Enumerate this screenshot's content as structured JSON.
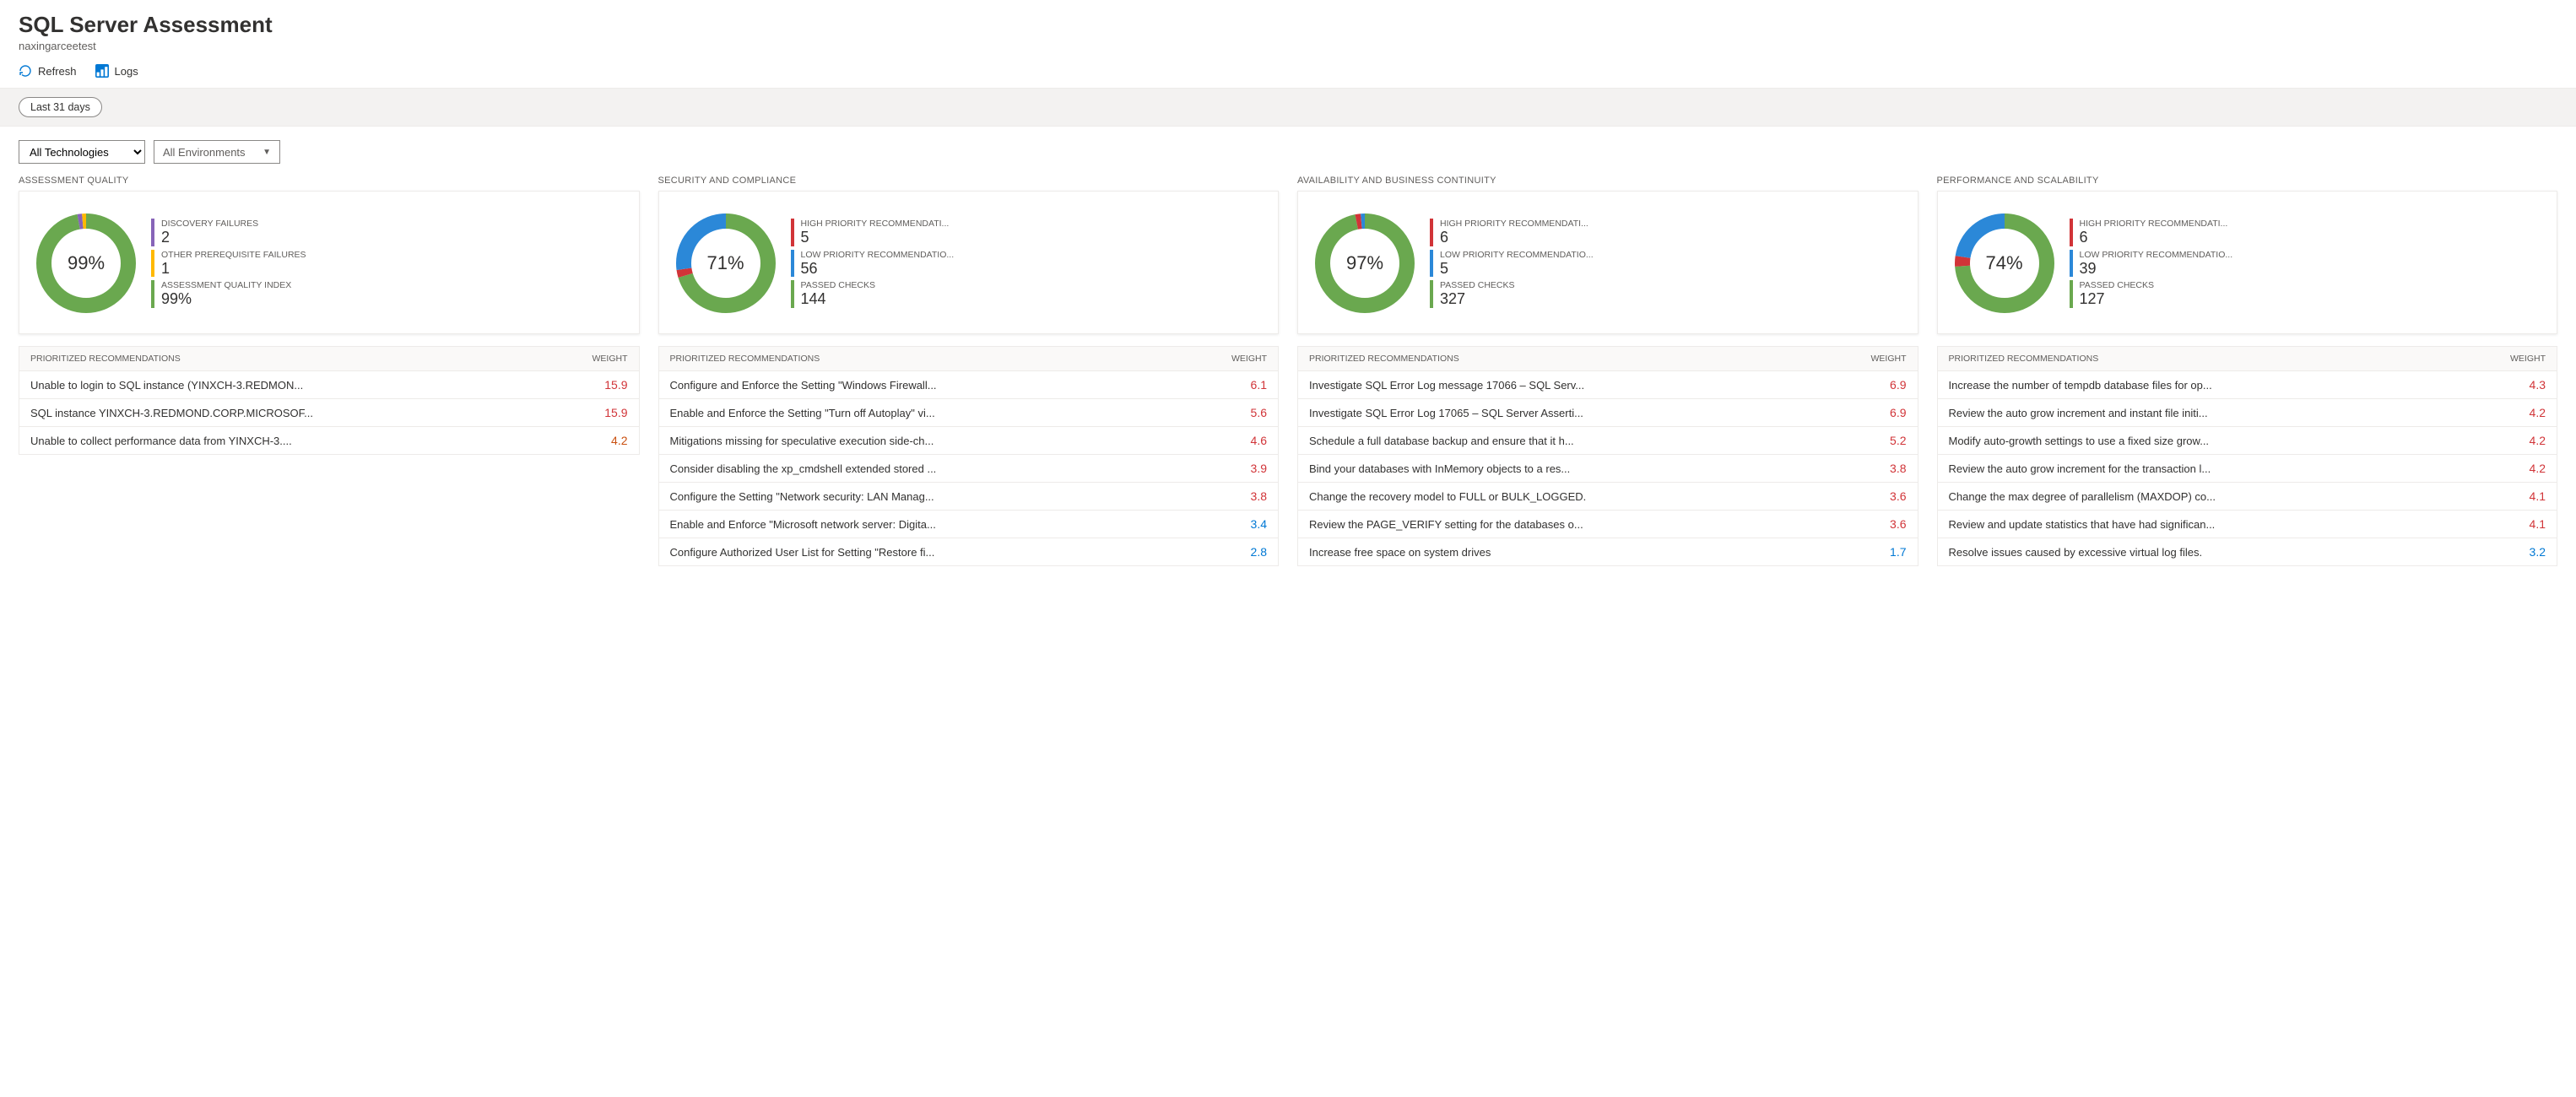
{
  "header": {
    "title": "SQL Server Assessment",
    "subtitle": "naxingarceetest"
  },
  "toolbar": {
    "refresh": "Refresh",
    "logs": "Logs"
  },
  "filter": {
    "range": "Last 31 days",
    "technologies": "All Technologies",
    "environments": "All Environments"
  },
  "labels": {
    "prioritized": "PRIORITIZED RECOMMENDATIONS",
    "weight": "WEIGHT"
  },
  "colors": {
    "green": "#6aa84f",
    "red": "#d13438",
    "blue": "#2b88d8",
    "purple": "#8764b8",
    "yellow": "#ffb900"
  },
  "cols": [
    {
      "title": "ASSESSMENT QUALITY",
      "center": "99%",
      "segments": [
        {
          "color": "#6aa84f",
          "pct": 97
        },
        {
          "color": "#8764b8",
          "pct": 1.5
        },
        {
          "color": "#ffb900",
          "pct": 1.5
        }
      ],
      "legend": [
        {
          "label": "DISCOVERY FAILURES",
          "value": "2",
          "color": "#8764b8"
        },
        {
          "label": "OTHER PREREQUISITE FAILURES",
          "value": "1",
          "color": "#ffb900"
        },
        {
          "label": "ASSESSMENT QUALITY INDEX",
          "value": "99%",
          "color": "#6aa84f"
        }
      ],
      "rows": [
        {
          "text": "Unable to login to SQL instance (YINXCH-3.REDMON...",
          "weight": "15.9",
          "cls": "w-red"
        },
        {
          "text": "SQL instance YINXCH-3.REDMOND.CORP.MICROSOF...",
          "weight": "15.9",
          "cls": "w-red"
        },
        {
          "text": "Unable to collect performance data from YINXCH-3....",
          "weight": "4.2",
          "cls": "w-orange"
        }
      ]
    },
    {
      "title": "SECURITY AND COMPLIANCE",
      "center": "71%",
      "segments": [
        {
          "color": "#6aa84f",
          "pct": 70.2
        },
        {
          "color": "#d13438",
          "pct": 2.5
        },
        {
          "color": "#2b88d8",
          "pct": 27.3
        }
      ],
      "legend": [
        {
          "label": "HIGH PRIORITY RECOMMENDATI...",
          "value": "5",
          "color": "#d13438"
        },
        {
          "label": "LOW PRIORITY RECOMMENDATIO...",
          "value": "56",
          "color": "#2b88d8"
        },
        {
          "label": "PASSED CHECKS",
          "value": "144",
          "color": "#6aa84f"
        }
      ],
      "rows": [
        {
          "text": "Configure and Enforce the Setting \"Windows Firewall...",
          "weight": "6.1",
          "cls": "w-red"
        },
        {
          "text": "Enable and Enforce the Setting \"Turn off Autoplay\" vi...",
          "weight": "5.6",
          "cls": "w-red"
        },
        {
          "text": "Mitigations missing for speculative execution side-ch...",
          "weight": "4.6",
          "cls": "w-red"
        },
        {
          "text": "Consider disabling the xp_cmdshell extended stored ...",
          "weight": "3.9",
          "cls": "w-red"
        },
        {
          "text": "Configure the Setting \"Network security: LAN Manag...",
          "weight": "3.8",
          "cls": "w-red"
        },
        {
          "text": "Enable and Enforce \"Microsoft network server: Digita...",
          "weight": "3.4",
          "cls": "w-blue"
        },
        {
          "text": "Configure Authorized User List for Setting \"Restore fi...",
          "weight": "2.8",
          "cls": "w-blue"
        }
      ]
    },
    {
      "title": "AVAILABILITY AND BUSINESS CONTINUITY",
      "center": "97%",
      "segments": [
        {
          "color": "#6aa84f",
          "pct": 96.7
        },
        {
          "color": "#d13438",
          "pct": 1.8
        },
        {
          "color": "#2b88d8",
          "pct": 1.5
        }
      ],
      "legend": [
        {
          "label": "HIGH PRIORITY RECOMMENDATI...",
          "value": "6",
          "color": "#d13438"
        },
        {
          "label": "LOW PRIORITY RECOMMENDATIO...",
          "value": "5",
          "color": "#2b88d8"
        },
        {
          "label": "PASSED CHECKS",
          "value": "327",
          "color": "#6aa84f"
        }
      ],
      "rows": [
        {
          "text": "Investigate SQL Error Log message 17066 – SQL Serv...",
          "weight": "6.9",
          "cls": "w-red"
        },
        {
          "text": "Investigate SQL Error Log 17065 – SQL Server Asserti...",
          "weight": "6.9",
          "cls": "w-red"
        },
        {
          "text": "Schedule a full database backup and ensure that it h...",
          "weight": "5.2",
          "cls": "w-red"
        },
        {
          "text": "Bind your databases with InMemory objects to a res...",
          "weight": "3.8",
          "cls": "w-red"
        },
        {
          "text": "Change the recovery model to FULL or BULK_LOGGED.",
          "weight": "3.6",
          "cls": "w-red"
        },
        {
          "text": "Review the PAGE_VERIFY setting for the databases o...",
          "weight": "3.6",
          "cls": "w-red"
        },
        {
          "text": "Increase free space on system drives",
          "weight": "1.7",
          "cls": "w-blue"
        }
      ]
    },
    {
      "title": "PERFORMANCE AND SCALABILITY",
      "center": "74%",
      "segments": [
        {
          "color": "#6aa84f",
          "pct": 73.8
        },
        {
          "color": "#d13438",
          "pct": 3.5
        },
        {
          "color": "#2b88d8",
          "pct": 22.7
        }
      ],
      "legend": [
        {
          "label": "HIGH PRIORITY RECOMMENDATI...",
          "value": "6",
          "color": "#d13438"
        },
        {
          "label": "LOW PRIORITY RECOMMENDATIO...",
          "value": "39",
          "color": "#2b88d8"
        },
        {
          "label": "PASSED CHECKS",
          "value": "127",
          "color": "#6aa84f"
        }
      ],
      "rows": [
        {
          "text": "Increase the number of tempdb database files for op...",
          "weight": "4.3",
          "cls": "w-red"
        },
        {
          "text": "Review the auto grow increment and instant file initi...",
          "weight": "4.2",
          "cls": "w-red"
        },
        {
          "text": "Modify auto-growth settings to use a fixed size grow...",
          "weight": "4.2",
          "cls": "w-red"
        },
        {
          "text": "Review the auto grow increment for the transaction l...",
          "weight": "4.2",
          "cls": "w-red"
        },
        {
          "text": "Change the max degree of parallelism (MAXDOP) co...",
          "weight": "4.1",
          "cls": "w-red"
        },
        {
          "text": "Review and update statistics that have had significan...",
          "weight": "4.1",
          "cls": "w-red"
        },
        {
          "text": "Resolve issues caused by excessive virtual log files.",
          "weight": "3.2",
          "cls": "w-blue"
        }
      ]
    }
  ],
  "chart_data": [
    {
      "type": "pie",
      "title": "ASSESSMENT QUALITY",
      "series": [
        {
          "name": "Discovery failures",
          "value": 2
        },
        {
          "name": "Other prerequisite failures",
          "value": 1
        },
        {
          "name": "Assessment quality index",
          "value": "99%"
        }
      ],
      "center": "99%"
    },
    {
      "type": "pie",
      "title": "SECURITY AND COMPLIANCE",
      "series": [
        {
          "name": "High priority recommendations",
          "value": 5
        },
        {
          "name": "Low priority recommendations",
          "value": 56
        },
        {
          "name": "Passed checks",
          "value": 144
        }
      ],
      "center": "71%"
    },
    {
      "type": "pie",
      "title": "AVAILABILITY AND BUSINESS CONTINUITY",
      "series": [
        {
          "name": "High priority recommendations",
          "value": 6
        },
        {
          "name": "Low priority recommendations",
          "value": 5
        },
        {
          "name": "Passed checks",
          "value": 327
        }
      ],
      "center": "97%"
    },
    {
      "type": "pie",
      "title": "PERFORMANCE AND SCALABILITY",
      "series": [
        {
          "name": "High priority recommendations",
          "value": 6
        },
        {
          "name": "Low priority recommendations",
          "value": 39
        },
        {
          "name": "Passed checks",
          "value": 127
        }
      ],
      "center": "74%"
    }
  ]
}
